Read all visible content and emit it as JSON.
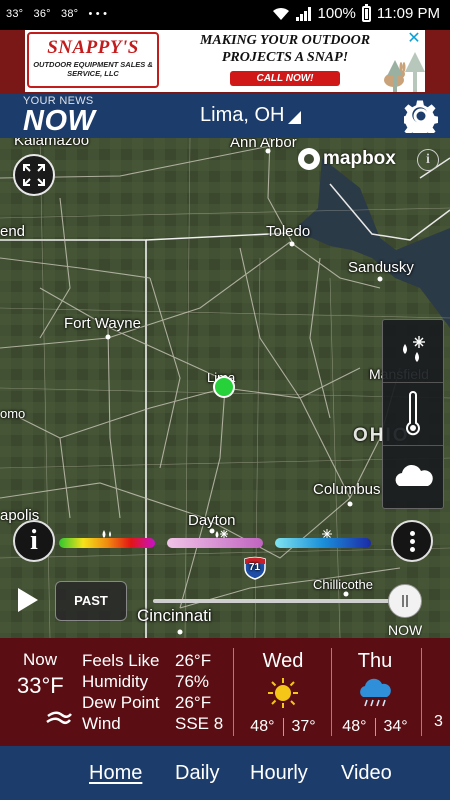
{
  "status_bar": {
    "temps": [
      "33°",
      "36°",
      "38°"
    ],
    "dots": "• • •",
    "battery": "100%",
    "time": "11:09 PM"
  },
  "ad": {
    "logo_main": "SNAPPY'S",
    "logo_sub": "OUTDOOR EQUIPMENT SALES & SERVICE, LLC",
    "headline": "MAKING YOUR OUTDOOR PROJECTS A SNAP!",
    "cta": "CALL NOW!",
    "close": "✕"
  },
  "header": {
    "brand_top": "YOUR NEWS",
    "brand_main": "NOW",
    "location": "Lima, OH"
  },
  "map": {
    "attribution": "mapbox",
    "info": "i",
    "labels": {
      "kalamazoo": "Kalamazoo",
      "ann_arbor": "Ann Arbor",
      "bend": "end",
      "toledo": "Toledo",
      "sandusky": "Sandusky",
      "fort_wayne": "Fort Wayne",
      "lima": "Lima",
      "mansfield": "Mansfield",
      "omo": "omo",
      "ohio": "OHIO",
      "columbus": "Columbus",
      "apolis": "apolis",
      "dayton": "Dayton",
      "i71": "71",
      "chillicothe": "Chillicothe",
      "cincinnati": "Cincinnati"
    },
    "info_button": "i",
    "past_button": "PAST",
    "now_label": "NOW",
    "colors": {
      "rain": [
        "#2ec62e",
        "#f4e21a",
        "#f08c10",
        "#e21414",
        "#c812c8"
      ],
      "mix": [
        "#f0c4e6",
        "#c064c0"
      ],
      "snow": [
        "#7fe3f0",
        "#1b8fd8",
        "#1c2aa8"
      ],
      "pin": "#27d13a"
    }
  },
  "current": {
    "label": "Now",
    "temp": "33°F",
    "feels_like_label": "Feels Like",
    "feels_like": "26°F",
    "humidity_label": "Humidity",
    "humidity": "76%",
    "dew_point_label": "Dew Point",
    "dew_point": "26°F",
    "wind_label": "Wind",
    "wind": "SSE 8"
  },
  "forecast": [
    {
      "day": "Wed",
      "icon": "sun-icon",
      "high": "48°",
      "low": "37°"
    },
    {
      "day": "Thu",
      "icon": "rain-cloud-icon",
      "high": "48°",
      "low": "34°"
    }
  ],
  "forecast_peek": "3",
  "nav": {
    "home": "Home",
    "daily": "Daily",
    "hourly": "Hourly",
    "video": "Video"
  }
}
